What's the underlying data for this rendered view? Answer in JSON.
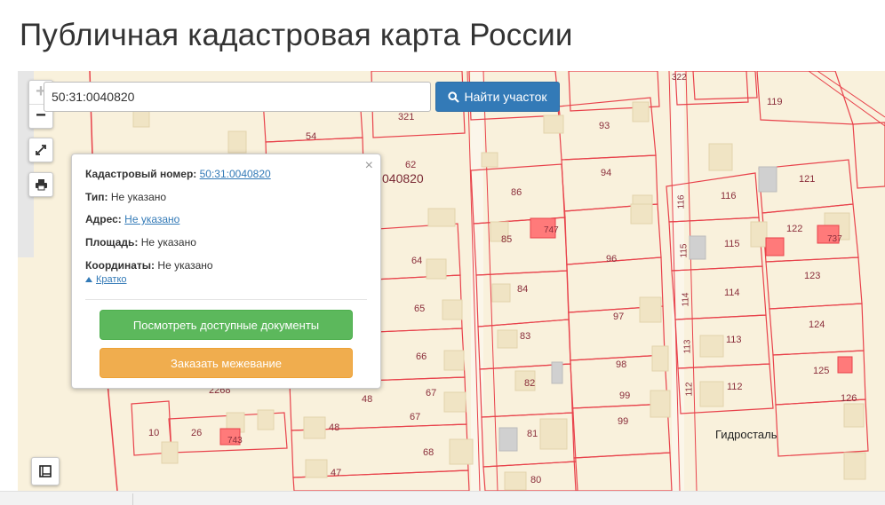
{
  "page": {
    "title": "Публичная кадастровая карта России"
  },
  "search": {
    "value": "50:31:0040820",
    "button_label": "Найти участок"
  },
  "map": {
    "zoom_in": "+",
    "zoom_out": "−",
    "quarter_label": "040820",
    "place_label": "Гидросталь",
    "parcel_numbers": [
      "321",
      "54",
      "62",
      "322",
      "119",
      "93",
      "94",
      "86",
      "85",
      "747",
      "96",
      "116",
      "121",
      "115",
      "122",
      "737",
      "123",
      "114",
      "124",
      "113",
      "125",
      "112",
      "126",
      "64",
      "65",
      "66",
      "67",
      "67",
      "68",
      "48",
      "48",
      "47",
      "84",
      "97",
      "83",
      "98",
      "82",
      "99",
      "99",
      "81",
      "80",
      "2268",
      "10",
      "26",
      "743",
      "116",
      "115",
      "114",
      "113",
      "112"
    ],
    "colors": {
      "parcel_border": "#e8424b",
      "fill": "#f9f1dc",
      "building": "#f0e4c4",
      "highlight": "#ff7a7a"
    }
  },
  "popup": {
    "cadastral_label": "Кадастровый номер:",
    "cadastral_value": "50:31:0040820",
    "type_label": "Тип:",
    "type_value": "Не указано",
    "address_label": "Адрес:",
    "address_value": "Не указано",
    "area_label": "Площадь:",
    "area_value": "Не указано",
    "coords_label": "Координаты:",
    "coords_value": "Не указано",
    "toggle_label": "Кратко",
    "docs_button": "Посмотреть доступные документы",
    "survey_button": "Заказать межевание",
    "close": "×"
  }
}
